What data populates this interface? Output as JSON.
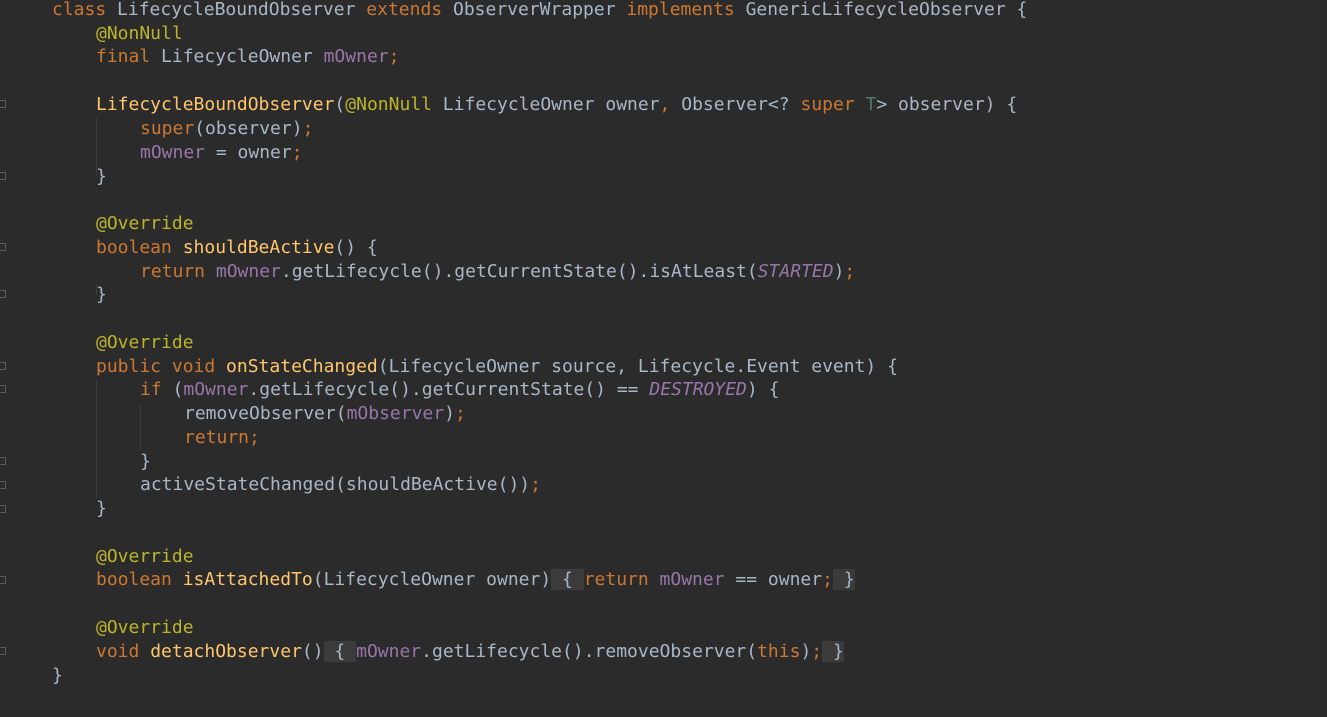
{
  "editor": {
    "lines": {
      "l1": {
        "kw_class": "class ",
        "name": "LifecycleBoundObserver ",
        "kw_extends": "extends ",
        "parent": "ObserverWrapper ",
        "kw_impl": "implements ",
        "iface": "GenericLifecycleObserver {"
      },
      "l2": {
        "ann": "@NonNull"
      },
      "l3": {
        "kw": "final ",
        "type": "LifecycleOwner ",
        "field": "mOwner",
        "semi": ";"
      },
      "l4": {
        "ctor": "LifecycleBoundObserver",
        "p1": "(",
        "ann": "@NonNull",
        "p2": " LifecycleOwner owner",
        "comma": ",",
        "p3": " Observer<? ",
        "kw_super": "super ",
        "tparam": "T",
        "p4": "> observer) {"
      },
      "l5": {
        "kw_super": "super",
        "rest": "(observer)",
        "semi": ";"
      },
      "l6": {
        "field": "mOwner",
        "rest": " = owner",
        "semi": ";"
      },
      "l7": {
        "text": "}"
      },
      "l8": {
        "ann": "@Override"
      },
      "l9": {
        "kw": "boolean ",
        "fn": "shouldBeActive",
        "rest": "() {"
      },
      "l10": {
        "kw": "return ",
        "field": "mOwner",
        "rest": ".getLifecycle().getCurrentState().isAtLeast(",
        "const": "STARTED",
        "end": ")",
        "semi": ";"
      },
      "l11": {
        "text": "}"
      },
      "l12": {
        "ann": "@Override"
      },
      "l13": {
        "kw": "public void ",
        "fn": "onStateChanged",
        "rest": "(LifecycleOwner source, Lifecycle.Event event) {"
      },
      "l14": {
        "kw": "if ",
        "p1": "(",
        "field": "mOwner",
        "rest": ".getLifecycle().getCurrentState() == ",
        "const": "DESTROYED",
        "end": ") {"
      },
      "l15": {
        "rest": "removeObserver(",
        "field": "mObserver",
        "end": ")",
        "semi": ";"
      },
      "l16": {
        "kw": "return",
        "semi": ";"
      },
      "l17": {
        "text": "}"
      },
      "l18": {
        "rest": "activeStateChanged(shouldBeActive())",
        "semi": ";"
      },
      "l19": {
        "text": "}"
      },
      "l20": {
        "ann": "@Override"
      },
      "l21": {
        "kw": "boolean ",
        "fn": "isAttachedTo",
        "rest": "(LifecycleOwner owner)",
        "fold_open": " { ",
        "kw2": "return ",
        "field": "mOwner",
        "rest2": " == owner",
        "semi": ";",
        "fold_close": " }"
      },
      "l22": {
        "ann": "@Override"
      },
      "l23": {
        "kw": "void ",
        "fn": "detachObserver",
        "rest": "()",
        "fold_open": " { ",
        "field": "mOwner",
        "rest2": ".getLifecycle().removeObserver(",
        "kw2": "this",
        "end": ")",
        "semi": ";",
        "fold_close": " }"
      },
      "l24": {
        "text": "}"
      }
    }
  }
}
